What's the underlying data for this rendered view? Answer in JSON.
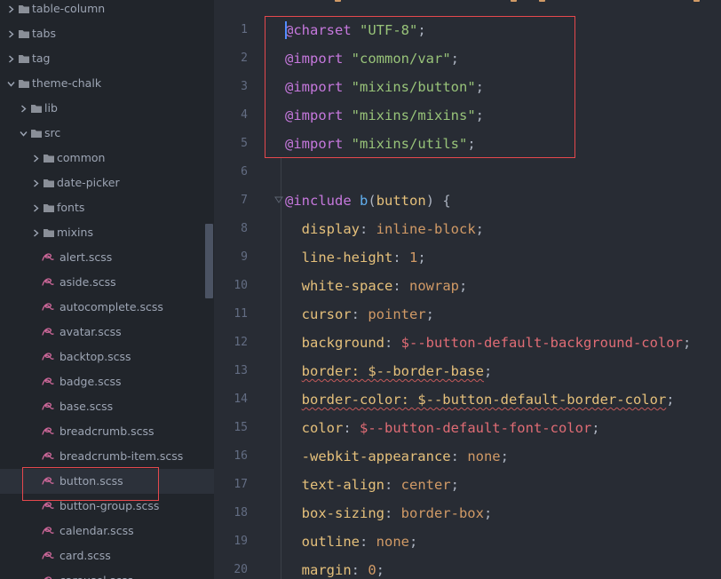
{
  "sidebar": {
    "items": [
      {
        "label": "table-column",
        "type": "folder",
        "depth": 0,
        "open": false
      },
      {
        "label": "tabs",
        "type": "folder",
        "depth": 0,
        "open": false
      },
      {
        "label": "tag",
        "type": "folder",
        "depth": 0,
        "open": false
      },
      {
        "label": "theme-chalk",
        "type": "folder",
        "depth": 0,
        "open": true
      },
      {
        "label": "lib",
        "type": "folder",
        "depth": 1,
        "open": false
      },
      {
        "label": "src",
        "type": "folder",
        "depth": 1,
        "open": true
      },
      {
        "label": "common",
        "type": "folder",
        "depth": 2,
        "open": false
      },
      {
        "label": "date-picker",
        "type": "folder",
        "depth": 2,
        "open": false
      },
      {
        "label": "fonts",
        "type": "folder",
        "depth": 2,
        "open": false
      },
      {
        "label": "mixins",
        "type": "folder",
        "depth": 2,
        "open": false
      },
      {
        "label": "alert.scss",
        "type": "file",
        "depth": 2
      },
      {
        "label": "aside.scss",
        "type": "file",
        "depth": 2
      },
      {
        "label": "autocomplete.scss",
        "type": "file",
        "depth": 2
      },
      {
        "label": "avatar.scss",
        "type": "file",
        "depth": 2
      },
      {
        "label": "backtop.scss",
        "type": "file",
        "depth": 2
      },
      {
        "label": "badge.scss",
        "type": "file",
        "depth": 2
      },
      {
        "label": "base.scss",
        "type": "file",
        "depth": 2
      },
      {
        "label": "breadcrumb.scss",
        "type": "file",
        "depth": 2
      },
      {
        "label": "breadcrumb-item.scss",
        "type": "file",
        "depth": 2
      },
      {
        "label": "button.scss",
        "type": "file",
        "depth": 2,
        "selected": true
      },
      {
        "label": "button-group.scss",
        "type": "file",
        "depth": 2
      },
      {
        "label": "calendar.scss",
        "type": "file",
        "depth": 2
      },
      {
        "label": "card.scss",
        "type": "file",
        "depth": 2
      },
      {
        "label": "carousel.scss",
        "type": "file",
        "depth": 2
      }
    ]
  },
  "editor": {
    "line_numbers": [
      "1",
      "2",
      "3",
      "4",
      "5",
      "6",
      "7",
      "8",
      "9",
      "10",
      "11",
      "12",
      "13",
      "14",
      "15",
      "16",
      "17",
      "18",
      "19",
      "20"
    ],
    "lines": [
      [
        {
          "t": "@charset",
          "c": "at"
        },
        {
          "t": " ",
          "c": "pun"
        },
        {
          "t": "\"UTF-8\"",
          "c": "str"
        },
        {
          "t": ";",
          "c": "pun"
        }
      ],
      [
        {
          "t": "@import",
          "c": "at"
        },
        {
          "t": " ",
          "c": "pun"
        },
        {
          "t": "\"common/var\"",
          "c": "str"
        },
        {
          "t": ";",
          "c": "pun"
        }
      ],
      [
        {
          "t": "@import",
          "c": "at"
        },
        {
          "t": " ",
          "c": "pun"
        },
        {
          "t": "\"mixins/button\"",
          "c": "str"
        },
        {
          "t": ";",
          "c": "pun"
        }
      ],
      [
        {
          "t": "@import",
          "c": "at"
        },
        {
          "t": " ",
          "c": "pun"
        },
        {
          "t": "\"mixins/mixins\"",
          "c": "str"
        },
        {
          "t": ";",
          "c": "pun"
        }
      ],
      [
        {
          "t": "@import",
          "c": "at"
        },
        {
          "t": " ",
          "c": "pun"
        },
        {
          "t": "\"mixins/utils\"",
          "c": "str"
        },
        {
          "t": ";",
          "c": "pun"
        }
      ],
      [],
      [
        {
          "t": "@include",
          "c": "at"
        },
        {
          "t": " ",
          "c": "pun"
        },
        {
          "t": "b",
          "c": "fn"
        },
        {
          "t": "(",
          "c": "pun"
        },
        {
          "t": "button",
          "c": "prop"
        },
        {
          "t": ") {",
          "c": "pun"
        }
      ],
      [
        {
          "t": "  display",
          "c": "prop"
        },
        {
          "t": ": ",
          "c": "pun"
        },
        {
          "t": "inline-block",
          "c": "num"
        },
        {
          "t": ";",
          "c": "pun"
        }
      ],
      [
        {
          "t": "  line-height",
          "c": "prop"
        },
        {
          "t": ": ",
          "c": "pun"
        },
        {
          "t": "1",
          "c": "num"
        },
        {
          "t": ";",
          "c": "pun"
        }
      ],
      [
        {
          "t": "  white-space",
          "c": "prop"
        },
        {
          "t": ": ",
          "c": "pun"
        },
        {
          "t": "nowrap",
          "c": "num"
        },
        {
          "t": ";",
          "c": "pun"
        }
      ],
      [
        {
          "t": "  cursor",
          "c": "prop"
        },
        {
          "t": ": ",
          "c": "pun"
        },
        {
          "t": "pointer",
          "c": "num"
        },
        {
          "t": ";",
          "c": "pun"
        }
      ],
      [
        {
          "t": "  background",
          "c": "prop"
        },
        {
          "t": ": ",
          "c": "pun"
        },
        {
          "t": "$--button-default-background-color",
          "c": "var"
        },
        {
          "t": ";",
          "c": "pun"
        }
      ],
      [
        {
          "t": "  ",
          "c": "pun"
        },
        {
          "t": "border: $--border-base",
          "c": "prop",
          "w": true
        },
        {
          "t": ";",
          "c": "pun"
        }
      ],
      [
        {
          "t": "  ",
          "c": "pun"
        },
        {
          "t": "border-color: $--button-default-border-color",
          "c": "prop",
          "w": true
        },
        {
          "t": ";",
          "c": "pun"
        }
      ],
      [
        {
          "t": "  color",
          "c": "prop"
        },
        {
          "t": ": ",
          "c": "pun"
        },
        {
          "t": "$--button-default-font-color",
          "c": "var"
        },
        {
          "t": ";",
          "c": "pun"
        }
      ],
      [
        {
          "t": "  -webkit-appearance",
          "c": "prop"
        },
        {
          "t": ": ",
          "c": "pun"
        },
        {
          "t": "none",
          "c": "num"
        },
        {
          "t": ";",
          "c": "pun"
        }
      ],
      [
        {
          "t": "  text-align",
          "c": "prop"
        },
        {
          "t": ": ",
          "c": "pun"
        },
        {
          "t": "center",
          "c": "num"
        },
        {
          "t": ";",
          "c": "pun"
        }
      ],
      [
        {
          "t": "  box-sizing",
          "c": "prop"
        },
        {
          "t": ": ",
          "c": "pun"
        },
        {
          "t": "border-box",
          "c": "num"
        },
        {
          "t": ";",
          "c": "pun"
        }
      ],
      [
        {
          "t": "  outline",
          "c": "prop"
        },
        {
          "t": ": ",
          "c": "pun"
        },
        {
          "t": "none",
          "c": "num"
        },
        {
          "t": ";",
          "c": "pun"
        }
      ],
      [
        {
          "t": "  margin",
          "c": "prop"
        },
        {
          "t": ": ",
          "c": "pun"
        },
        {
          "t": "0",
          "c": "num"
        },
        {
          "t": ";",
          "c": "pun"
        }
      ]
    ]
  },
  "colors": {
    "folder": "#8a8f98",
    "sass": "#cd6799",
    "highlight": "#e5484d"
  }
}
